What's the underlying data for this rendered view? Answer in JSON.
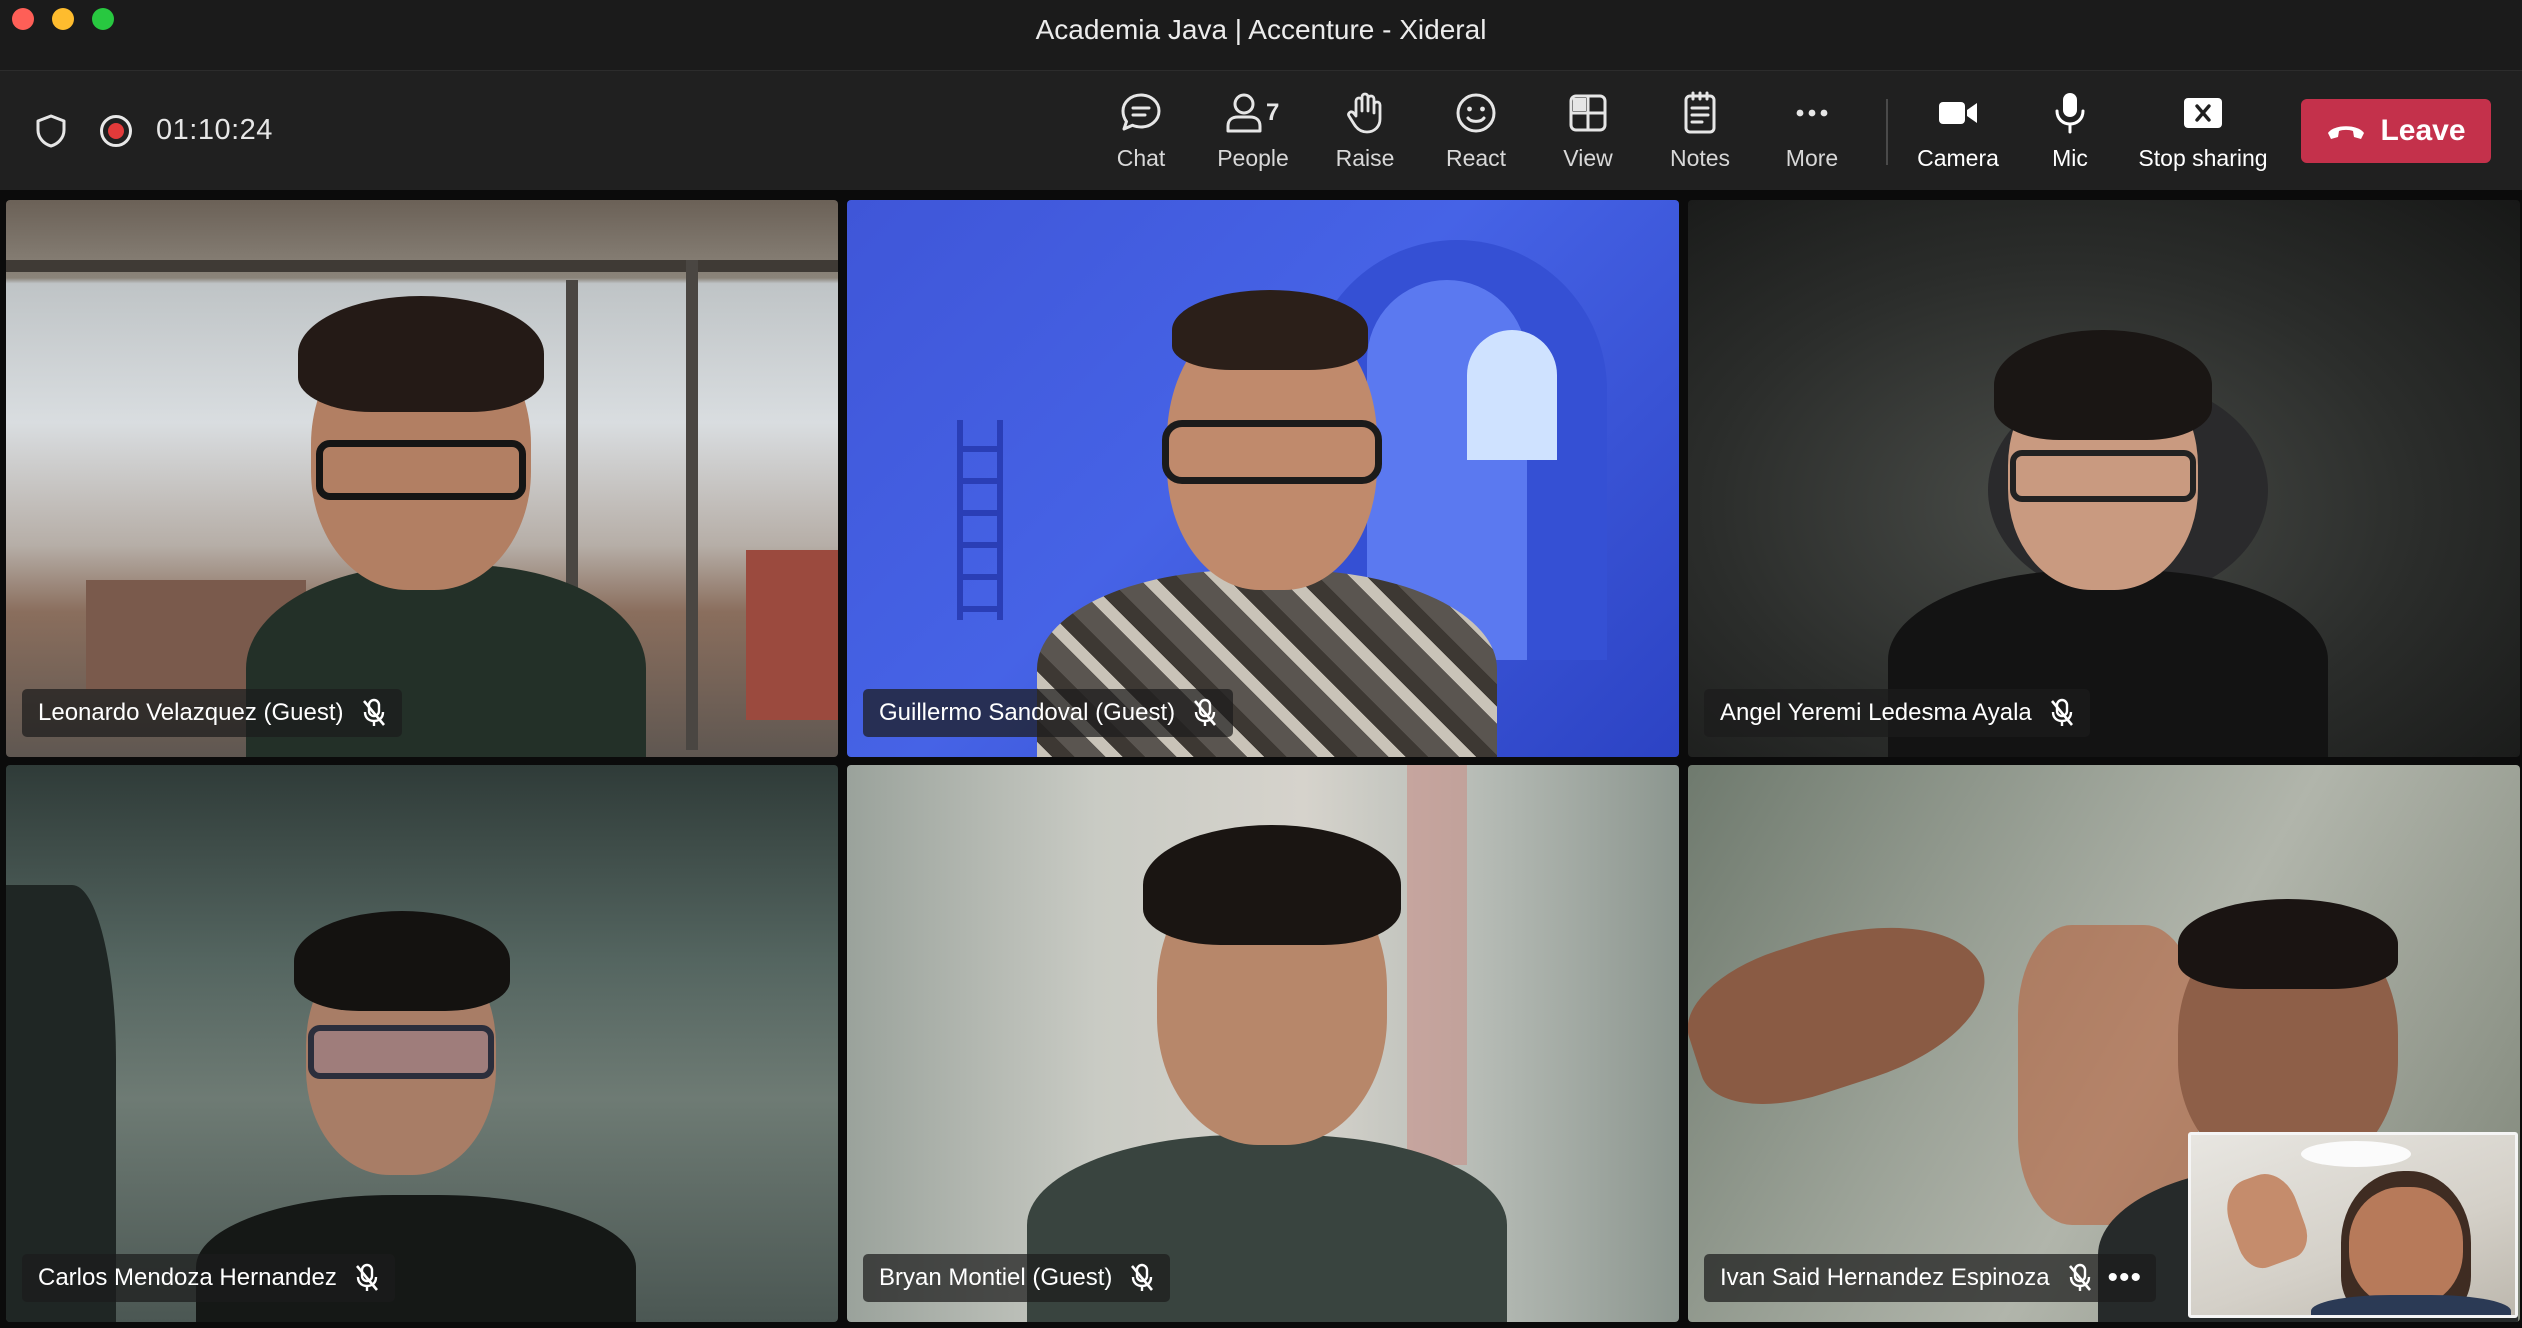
{
  "window": {
    "title": "Academia Java | Accenture - Xideral"
  },
  "toolbar": {
    "timer": "01:10:24",
    "people_count": "7",
    "buttons": {
      "chat": "Chat",
      "people": "People",
      "raise": "Raise",
      "react": "React",
      "view": "View",
      "notes": "Notes",
      "more": "More",
      "camera": "Camera",
      "mic": "Mic",
      "stop_sharing": "Stop sharing"
    },
    "leave_label": "Leave",
    "colors": {
      "leave": "#c4314b",
      "recording": "#e23a3a"
    }
  },
  "participants": [
    {
      "name": "Leonardo Velazquez (Guest)",
      "muted": true
    },
    {
      "name": "Guillermo Sandoval (Guest)",
      "muted": true
    },
    {
      "name": "Angel Yeremi Ledesma Ayala",
      "muted": true
    },
    {
      "name": "Carlos Mendoza Hernandez",
      "muted": true
    },
    {
      "name": "Bryan Montiel (Guest)",
      "muted": true
    },
    {
      "name": "Ivan Said Hernandez Espinoza",
      "muted": true
    }
  ],
  "icons": {
    "shield": "shield-icon",
    "recording": "recording-icon",
    "chat": "chat-icon",
    "people": "people-icon",
    "raise": "raise-hand-icon",
    "react": "react-smiley-icon",
    "view": "view-layout-icon",
    "notes": "notes-icon",
    "more": "more-dots-icon",
    "camera": "camera-icon",
    "mic": "mic-icon",
    "stop_sharing": "stop-sharing-icon",
    "leave": "phone-hangup-icon",
    "muted": "mic-muted-icon"
  }
}
